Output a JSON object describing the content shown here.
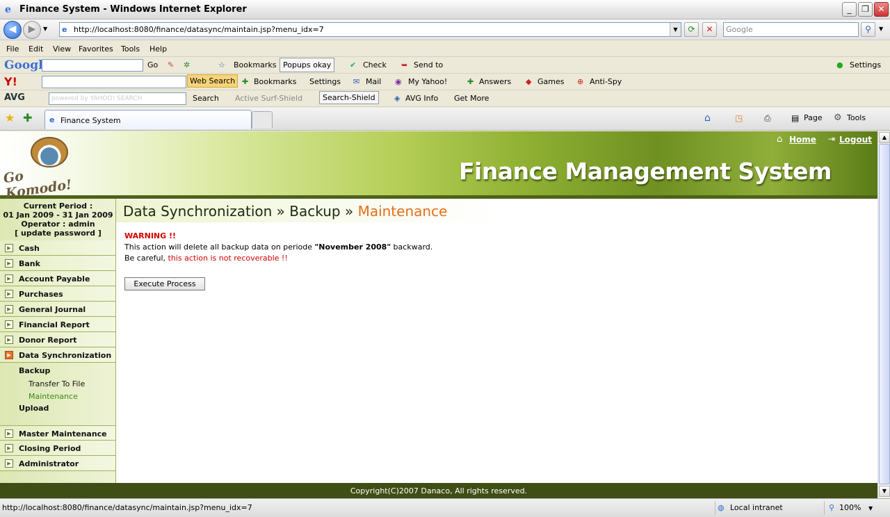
{
  "window": {
    "title": "Finance System - Windows Internet Explorer"
  },
  "address": {
    "url": "http://localhost:8080/finance/datasync/maintain.jsp?menu_idx=7",
    "search_placeholder": "Google"
  },
  "menu": [
    "File",
    "Edit",
    "View",
    "Favorites",
    "Tools",
    "Help"
  ],
  "google_bar": {
    "logo": "Google",
    "go": "Go",
    "bookmarks": "Bookmarks",
    "popups": "Popups okay",
    "check": "Check",
    "send_to": "Send to",
    "settings": "Settings"
  },
  "yahoo_bar": {
    "logo": "Y!",
    "web_search": "Web Search",
    "bookmarks": "Bookmarks",
    "settings": "Settings",
    "mail": "Mail",
    "my_yahoo": "My Yahoo!",
    "answers": "Answers",
    "games": "Games",
    "anti_spy": "Anti-Spy"
  },
  "avg_bar": {
    "logo": "AVG",
    "search_watermark": "powered by YAHOO! SEARCH",
    "search": "Search",
    "active_surf": "Active  Surf-Shield",
    "search_shield": "Search-Shield",
    "avg_info": "AVG Info",
    "get_more": "Get More"
  },
  "tabs": {
    "active": "Finance System",
    "page": "Page",
    "tools": "Tools"
  },
  "header": {
    "title": "Finance Management System",
    "home": "Home",
    "logout": "Logout",
    "logo_text": "Go Komodo!"
  },
  "sidebar": {
    "period_label": "Current Period :",
    "period_range": "01 Jan 2009 - 31 Jan 2009",
    "operator": "Operator : admin",
    "update_password": "[ update password ]",
    "items_top": [
      "Cash",
      "Bank",
      "Account Payable",
      "Purchases",
      "General Journal",
      "Financial Report",
      "Donor Report",
      "Data Synchronization"
    ],
    "sub": {
      "backup": "Backup",
      "transfer": "Transfer To File",
      "maintenance": "Maintenance",
      "upload": "Upload"
    },
    "items_bottom": [
      "Master Maintenance",
      "Closing Period",
      "Administrator"
    ]
  },
  "breadcrumb": {
    "a": "Data Synchronization",
    "sep": "»",
    "b": "Backup",
    "c": "Maintenance"
  },
  "content": {
    "warning": "WARNING !!",
    "line1_pre": "This action will delete all backup data on periode ",
    "line1_bold": "\"November 2008\"",
    "line1_post": " backward.",
    "line2_pre": "Be careful, ",
    "line2_red": "this action is not recoverable !!",
    "button": "Execute Process"
  },
  "footer": "Copyright(C)2007 Danaco, All rights reserved.",
  "status": {
    "url": "http://localhost:8080/finance/datasync/maintain.jsp?menu_idx=7",
    "zone": "Local intranet",
    "zoom": "100%"
  },
  "colors": {
    "accent": "#e56f1a",
    "warning": "#d40000",
    "footer": "#3f4e14"
  }
}
